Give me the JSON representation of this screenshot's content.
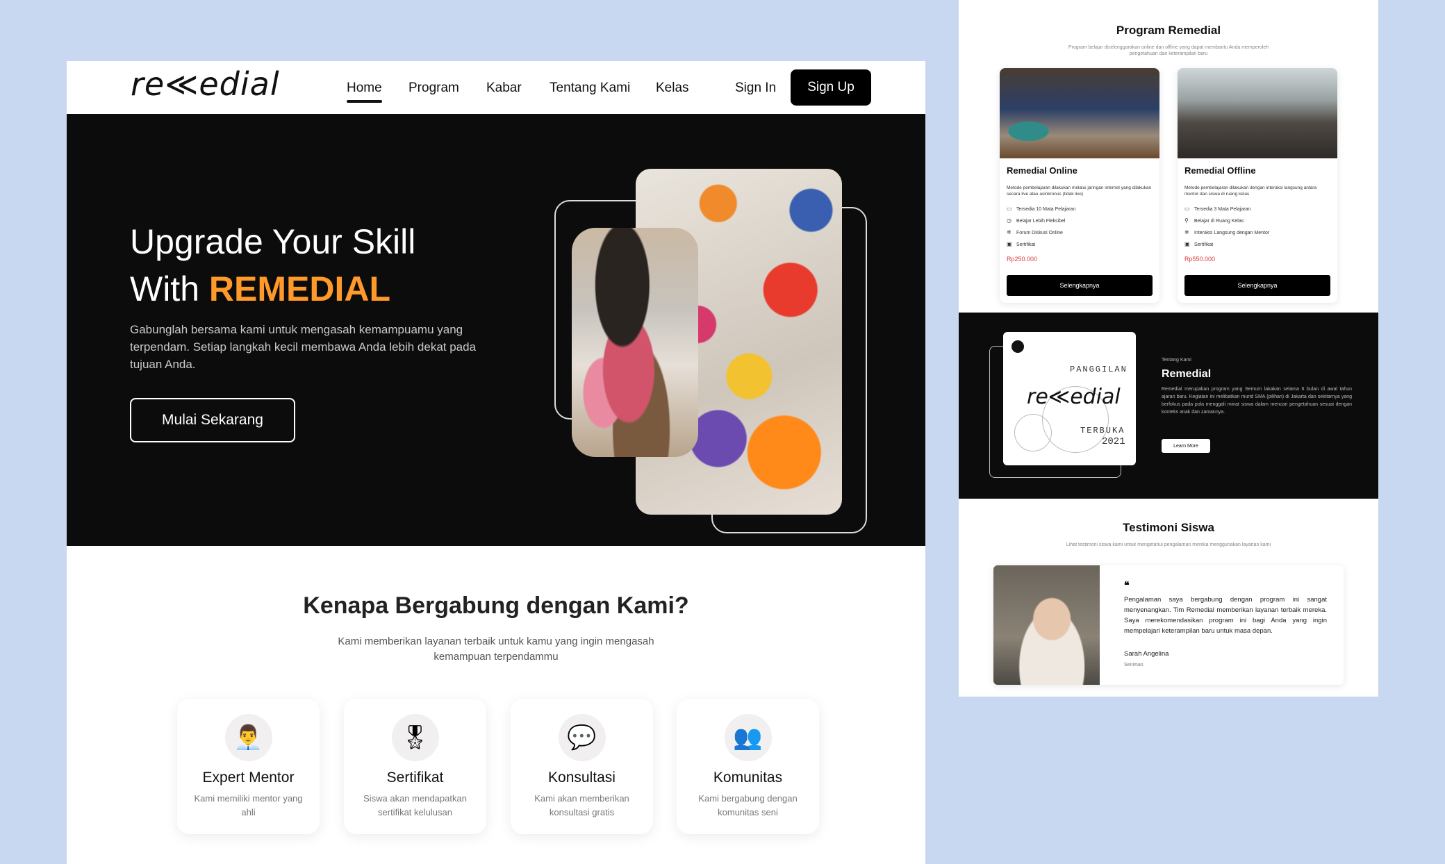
{
  "left": {
    "nav": {
      "logo": "re≪edial",
      "items": [
        "Home",
        "Program",
        "Kabar",
        "Tentang Kami",
        "Kelas"
      ],
      "signin": "Sign In",
      "signup": "Sign Up"
    },
    "hero": {
      "title_line1": "Upgrade Your Skill",
      "title_prefix": "With ",
      "title_accent": "REMEDIAL",
      "description": "Gabunglah bersama kami untuk mengasah kemampuamu yang terpendam. Setiap langkah kecil membawa Anda lebih dekat pada tujuan Anda.",
      "cta": "Mulai Sekarang"
    },
    "why": {
      "title": "Kenapa Bergabung dengan Kami?",
      "subtitle": "Kami memberikan layanan terbaik untuk kamu yang ingin mengasah kemampuan terpendammu",
      "features": [
        {
          "icon": "mentor-icon",
          "glyph": "👨‍💼",
          "title": "Expert Mentor",
          "desc": "Kami memiliki mentor yang ahli"
        },
        {
          "icon": "certificate-icon",
          "glyph": "🎖",
          "title": "Sertifikat",
          "desc": "Siswa akan mendapatkan sertifikat kelulusan"
        },
        {
          "icon": "consultation-icon",
          "glyph": "💬",
          "title": "Konsultasi",
          "desc": "Kami akan memberikan konsultasi gratis"
        },
        {
          "icon": "community-icon",
          "glyph": "👥",
          "title": "Komunitas",
          "desc": "Kami bergabung dengan komunitas seni"
        }
      ]
    }
  },
  "right": {
    "program": {
      "title": "Program Remedial",
      "subtitle": "Program belajar diselenggarakan online dan offline yang dapat membantu Anda memperoleh pengetahuan dan keterampilan baru",
      "cards": [
        {
          "title": "Remedial Online",
          "desc": "Metode pembelajaran dilakukan melalui jaringan internet yang dilakukan secara live atau asinkronus (tidak live)",
          "features": [
            "Tersedia 10 Mata Pelajaran",
            "Belajar Lebih Fleksibel",
            "Forum Diskusi Online",
            "Sertifikat"
          ],
          "price": "Rp250.000",
          "button": "Selengkapnya"
        },
        {
          "title": "Remedial Offline",
          "desc": "Metode pembelajaran dilakukan dengan interaksi langsung antara mentor dan siswa di ruang kelas",
          "features": [
            "Tersedia 3 Mata Pelajaran",
            "Belajar di Ruang Kelas",
            "Interaksi Langsung dengan Mentor",
            "Sertifikat"
          ],
          "price": "Rp550.000",
          "button": "Selengkapnya"
        }
      ]
    },
    "about": {
      "poster_top": "PANGGILAN",
      "poster_logo": "re≪edial",
      "poster_bottom": "TERBUKA",
      "poster_year": "2021",
      "label": "Tentang Kami",
      "title": "Remedial",
      "desc": "Remedial merupakan program yang Semum lakakan selama 6 bulan di awal tahun ajaran baru. Kegiatan ini melibatkan murid SMA (pilihan) di Jakarta dan sekitarnya yang berfokus pada pola menggali minat siswa dalam mencari pengetahuan sesuai dengan konteks anak dan zamannya.",
      "button": "Learn More"
    },
    "testimonial": {
      "title": "Testimoni Siswa",
      "subtitle": "Lihat testimoni siswa kami untuk mengetahui pengalaman mereka menggunakan layanan kami",
      "quote_mark": "❝",
      "text": "Pengalaman saya bergabung dengan program ini sangat menyenangkan. Tim Remedial memberikan layanan terbaik mereka. Saya merekomendasikan program ini bagi Anda yang ingin mempelajari keterampilan baru untuk masa depan.",
      "name": "Sarah Angelina",
      "role": "Seniman"
    }
  }
}
